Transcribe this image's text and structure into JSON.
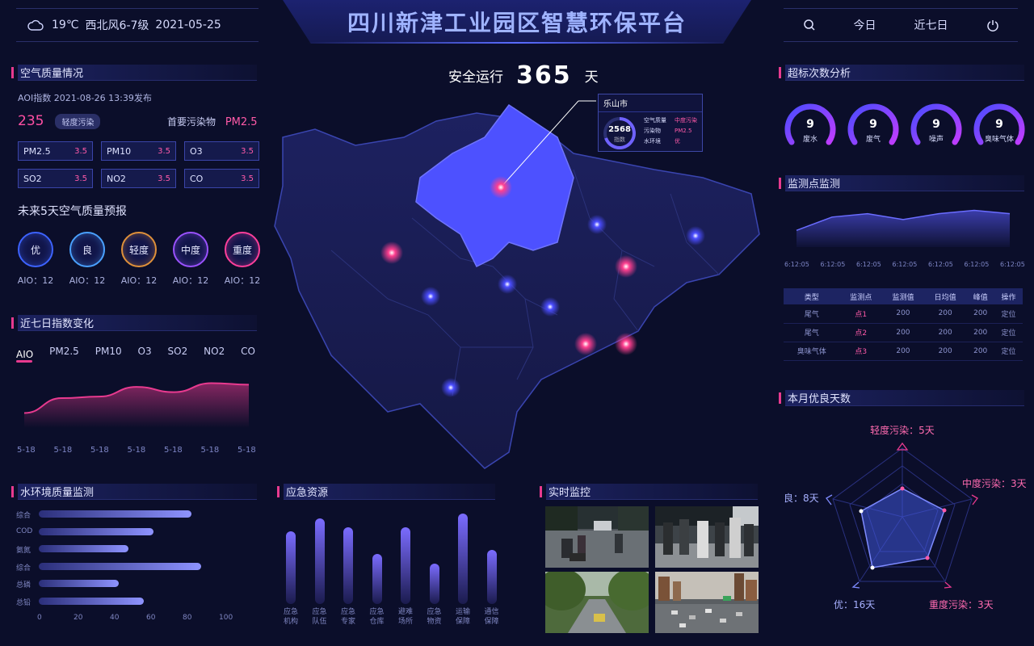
{
  "header": {
    "weather": "19℃",
    "wind": "西北风6-7级",
    "date": "2021-05-25",
    "title": "四川新津工业园区智慧环保平台",
    "today": "今日",
    "last7": "近七日"
  },
  "safety": {
    "prefix": "安全运行",
    "days": "365",
    "suffix": "天"
  },
  "air": {
    "title": "空气质量情况",
    "published": "AOI指数 2021-08-26 13:39发布",
    "aqi": "235",
    "badge": "轻度污染",
    "primary_label": "首要污染物",
    "primary_value": "PM2.5",
    "pollutants": [
      {
        "name": "PM2.5",
        "value": "3.5"
      },
      {
        "name": "PM10",
        "value": "3.5"
      },
      {
        "name": "O3",
        "value": "3.5"
      },
      {
        "name": "SO2",
        "value": "3.5"
      },
      {
        "name": "NO2",
        "value": "3.5"
      },
      {
        "name": "CO",
        "value": "3.5"
      }
    ],
    "forecast_title": "未来5天空气质量预报",
    "forecast": [
      {
        "label": "优",
        "aio": "AIO：12",
        "color": "#3d63ff"
      },
      {
        "label": "良",
        "aio": "AIO：12",
        "color": "#4aa1ff"
      },
      {
        "label": "轻度",
        "aio": "AIO：12",
        "color": "#e0913a"
      },
      {
        "label": "中度",
        "aio": "AIO：12",
        "color": "#9a52ff"
      },
      {
        "label": "重度",
        "aio": "AIO：12",
        "color": "#ff3f9b"
      }
    ]
  },
  "trend": {
    "title": "近七日指数变化",
    "tabs": [
      "AIO",
      "PM2.5",
      "PM10",
      "O3",
      "SO2",
      "NO2",
      "CO"
    ],
    "active_tab": 0
  },
  "water": {
    "title": "水环境质量监测"
  },
  "resources": {
    "title": "应急资源"
  },
  "monitor": {
    "title": "实时监控"
  },
  "exceed": {
    "title": "超标次数分析",
    "gauges": [
      {
        "value": "9",
        "label": "废水"
      },
      {
        "value": "9",
        "label": "废气"
      },
      {
        "value": "9",
        "label": "噪声"
      },
      {
        "value": "9",
        "label": "臭味气体"
      }
    ]
  },
  "points": {
    "title": "监测点监测",
    "columns": [
      "类型",
      "监测点",
      "监测值",
      "日均值",
      "峰值",
      "操作"
    ],
    "rows": [
      [
        "尾气",
        "点1",
        "200",
        "200",
        "200",
        "定位"
      ],
      [
        "尾气",
        "点2",
        "200",
        "200",
        "200",
        "定位"
      ],
      [
        "臭味气体",
        "点3",
        "200",
        "200",
        "200",
        "定位"
      ]
    ]
  },
  "good_days": {
    "title": "本月优良天数",
    "labels": {
      "light": "轻度污染：5天",
      "medium": "中度污染：3天",
      "heavy": "重度污染：3天",
      "excellent": "优：16天",
      "good": "良：8天"
    }
  },
  "popup": {
    "city": "乐山市",
    "index_value": "2568",
    "index_label": "指数",
    "rows": [
      {
        "k": "空气质量",
        "v": "中度污染"
      },
      {
        "k": "污染物",
        "v": "PM2.5"
      },
      {
        "k": "水环境",
        "v": "优"
      }
    ]
  },
  "chart_data": [
    {
      "type": "area",
      "title": "近七日指数变化",
      "categories": [
        "5-18",
        "5-18",
        "5-18",
        "5-18",
        "5-18",
        "5-18",
        "5-18"
      ],
      "values": [
        20,
        40,
        42,
        55,
        48,
        60,
        58
      ],
      "ylim": [
        0,
        80
      ]
    },
    {
      "type": "area",
      "title": "监测点监测",
      "categories": [
        "6:12:05",
        "6:12:05",
        "6:12:05",
        "6:12:05",
        "6:12:05",
        "6:12:05",
        "6:12:05"
      ],
      "values": [
        20,
        36,
        40,
        33,
        40,
        44,
        40
      ],
      "ylim": [
        0,
        60
      ]
    },
    {
      "type": "bar",
      "title": "水环境质量监测",
      "categories": [
        "综合",
        "COD",
        "氨氮",
        "综合",
        "总磷",
        "总铅"
      ],
      "values": [
        80,
        60,
        47,
        85,
        42,
        55
      ],
      "xticks": [
        "0",
        "20",
        "40",
        "60",
        "80",
        "100"
      ],
      "xlim": [
        0,
        100
      ]
    },
    {
      "type": "bar",
      "title": "应急资源",
      "categories": [
        "应急机构",
        "应急队伍",
        "应急专家",
        "应急仓库",
        "避难场所",
        "应急物资",
        "运输保障",
        "通信保障"
      ],
      "values": [
        80,
        95,
        85,
        55,
        85,
        45,
        100,
        60
      ]
    }
  ],
  "colors": {
    "accent": "#e83a8f",
    "primary": "#5a5cff",
    "bg": "#0b0e2a"
  }
}
